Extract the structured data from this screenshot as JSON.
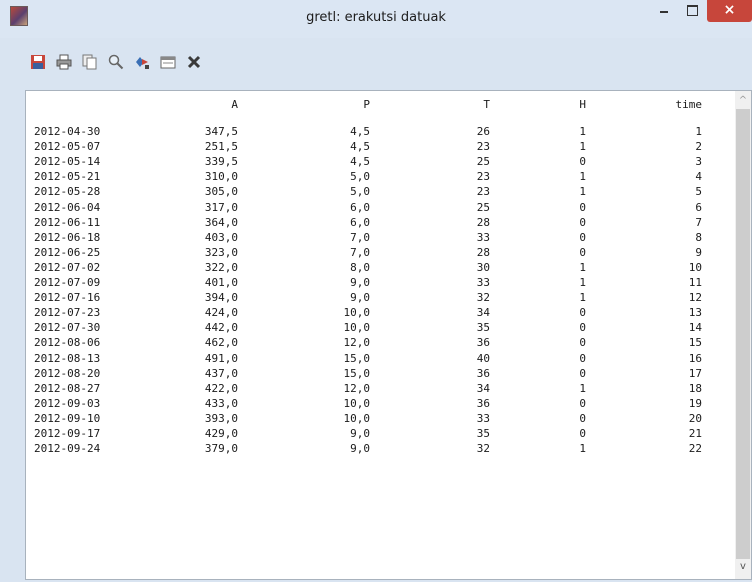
{
  "window": {
    "title": "gretl: erakutsi datuak",
    "close_label": "×"
  },
  "toolbar": {
    "icons": [
      "save-icon",
      "print-icon",
      "copy-icon",
      "find-icon",
      "edit-values-icon",
      "window-list-icon",
      "close-icon"
    ]
  },
  "table": {
    "headers": [
      "A",
      "P",
      "T",
      "H",
      "time"
    ],
    "rows": [
      [
        "2012-04-30",
        "347,5",
        "4,5",
        "26",
        "1",
        "1"
      ],
      [
        "2012-05-07",
        "251,5",
        "4,5",
        "23",
        "1",
        "2"
      ],
      [
        "2012-05-14",
        "339,5",
        "4,5",
        "25",
        "0",
        "3"
      ],
      [
        "2012-05-21",
        "310,0",
        "5,0",
        "23",
        "1",
        "4"
      ],
      [
        "2012-05-28",
        "305,0",
        "5,0",
        "23",
        "1",
        "5"
      ],
      [
        "2012-06-04",
        "317,0",
        "6,0",
        "25",
        "0",
        "6"
      ],
      [
        "2012-06-11",
        "364,0",
        "6,0",
        "28",
        "0",
        "7"
      ],
      [
        "2012-06-18",
        "403,0",
        "7,0",
        "33",
        "0",
        "8"
      ],
      [
        "2012-06-25",
        "323,0",
        "7,0",
        "28",
        "0",
        "9"
      ],
      [
        "2012-07-02",
        "322,0",
        "8,0",
        "30",
        "1",
        "10"
      ],
      [
        "2012-07-09",
        "401,0",
        "9,0",
        "33",
        "1",
        "11"
      ],
      [
        "2012-07-16",
        "394,0",
        "9,0",
        "32",
        "1",
        "12"
      ],
      [
        "2012-07-23",
        "424,0",
        "10,0",
        "34",
        "0",
        "13"
      ],
      [
        "2012-07-30",
        "442,0",
        "10,0",
        "35",
        "0",
        "14"
      ],
      [
        "2012-08-06",
        "462,0",
        "12,0",
        "36",
        "0",
        "15"
      ],
      [
        "2012-08-13",
        "491,0",
        "15,0",
        "40",
        "0",
        "16"
      ],
      [
        "2012-08-20",
        "437,0",
        "15,0",
        "36",
        "0",
        "17"
      ],
      [
        "2012-08-27",
        "422,0",
        "12,0",
        "34",
        "1",
        "18"
      ],
      [
        "2012-09-03",
        "433,0",
        "10,0",
        "36",
        "0",
        "19"
      ],
      [
        "2012-09-10",
        "393,0",
        "10,0",
        "33",
        "0",
        "20"
      ],
      [
        "2012-09-17",
        "429,0",
        "9,0",
        "35",
        "0",
        "21"
      ],
      [
        "2012-09-24",
        "379,0",
        "9,0",
        "32",
        "1",
        "22"
      ]
    ]
  },
  "scrollbar": {
    "up_arrow": "^",
    "down_arrow": "v"
  }
}
